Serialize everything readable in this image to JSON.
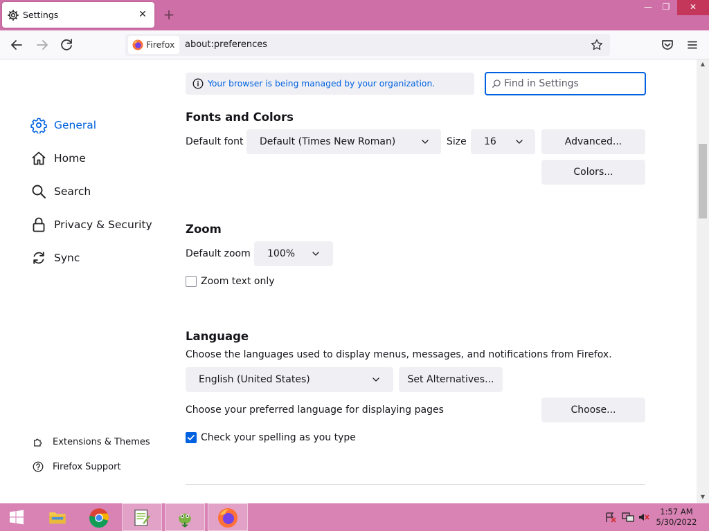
{
  "window": {
    "tab_title": "Settings",
    "tab_close_glyph": "✕",
    "new_tab_glyph": "+",
    "controls": {
      "minimize": "—",
      "restore": "❐",
      "close": "✕"
    }
  },
  "navbar": {
    "identity_label": "Firefox",
    "url": "about:preferences"
  },
  "banner": {
    "text": "Your browser is being managed by your organization."
  },
  "search": {
    "placeholder": "Find in Settings"
  },
  "sidebar": {
    "items": [
      {
        "label": "General",
        "icon": "gear-icon",
        "active": true
      },
      {
        "label": "Home",
        "icon": "home-icon"
      },
      {
        "label": "Search",
        "icon": "search-icon"
      },
      {
        "label": "Privacy & Security",
        "icon": "lock-icon"
      },
      {
        "label": "Sync",
        "icon": "sync-icon"
      }
    ],
    "footer": [
      {
        "label": "Extensions & Themes",
        "icon": "puzzle-icon"
      },
      {
        "label": "Firefox Support",
        "icon": "help-icon"
      }
    ]
  },
  "fonts": {
    "heading": "Fonts and Colors",
    "default_font_label": "Default font",
    "default_font_value": "Default (Times New Roman)",
    "size_label": "Size",
    "size_value": "16",
    "advanced_button": "Advanced...",
    "colors_button": "Colors..."
  },
  "zoom": {
    "heading": "Zoom",
    "default_zoom_label": "Default zoom",
    "default_zoom_value": "100%",
    "zoom_text_only_label": "Zoom text only",
    "zoom_text_only_checked": false
  },
  "language": {
    "heading": "Language",
    "description": "Choose the languages used to display menus, messages, and notifications from Firefox.",
    "language_value": "English (United States)",
    "set_alternatives_button": "Set Alternatives...",
    "pages_label": "Choose your preferred language for displaying pages",
    "choose_button": "Choose...",
    "spellcheck_label": "Check your spelling as you type",
    "spellcheck_checked": true
  },
  "taskbar": {
    "time": "1:57 AM",
    "date": "5/30/2022"
  }
}
